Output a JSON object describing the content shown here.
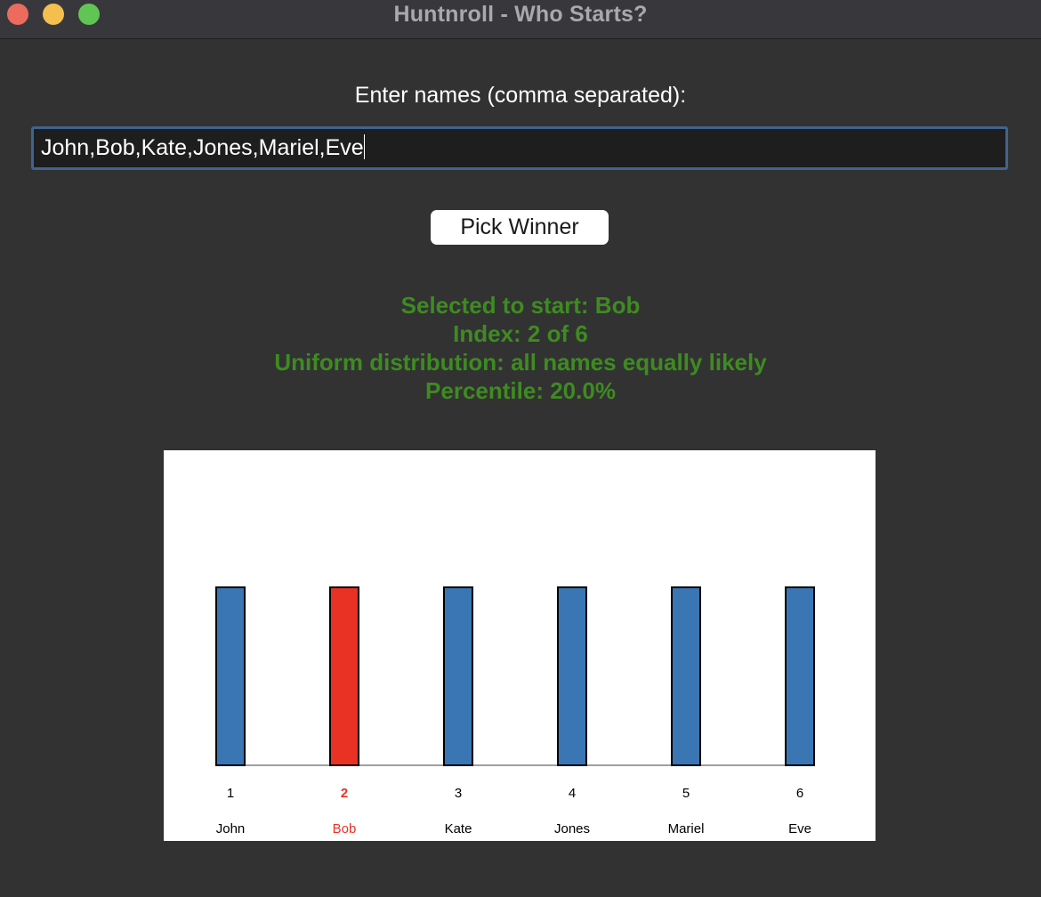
{
  "window": {
    "title": "Huntnroll - Who Starts?"
  },
  "form": {
    "label": "Enter names (comma separated):",
    "names_value": "John,Bob,Kate,Jones,Mariel,Eve",
    "pick_button": "Pick Winner"
  },
  "result": {
    "selected": "Selected to start: Bob",
    "index": "Index: 2 of 6",
    "distribution": "Uniform distribution: all names equally likely",
    "percentile": "Percentile: 20.0%"
  },
  "colors": {
    "bar": "#3a76b3",
    "selected_bar": "#e93223",
    "result_text": "#3e8b21"
  },
  "chart_data": {
    "type": "bar",
    "categories": [
      "John",
      "Bob",
      "Kate",
      "Jones",
      "Mariel",
      "Eve"
    ],
    "index_labels": [
      "1",
      "2",
      "3",
      "4",
      "5",
      "6"
    ],
    "values": [
      1,
      1,
      1,
      1,
      1,
      1
    ],
    "selected_index": 1,
    "ylim": [
      0,
      1.75
    ],
    "title": "",
    "xlabel": "",
    "ylabel": ""
  }
}
